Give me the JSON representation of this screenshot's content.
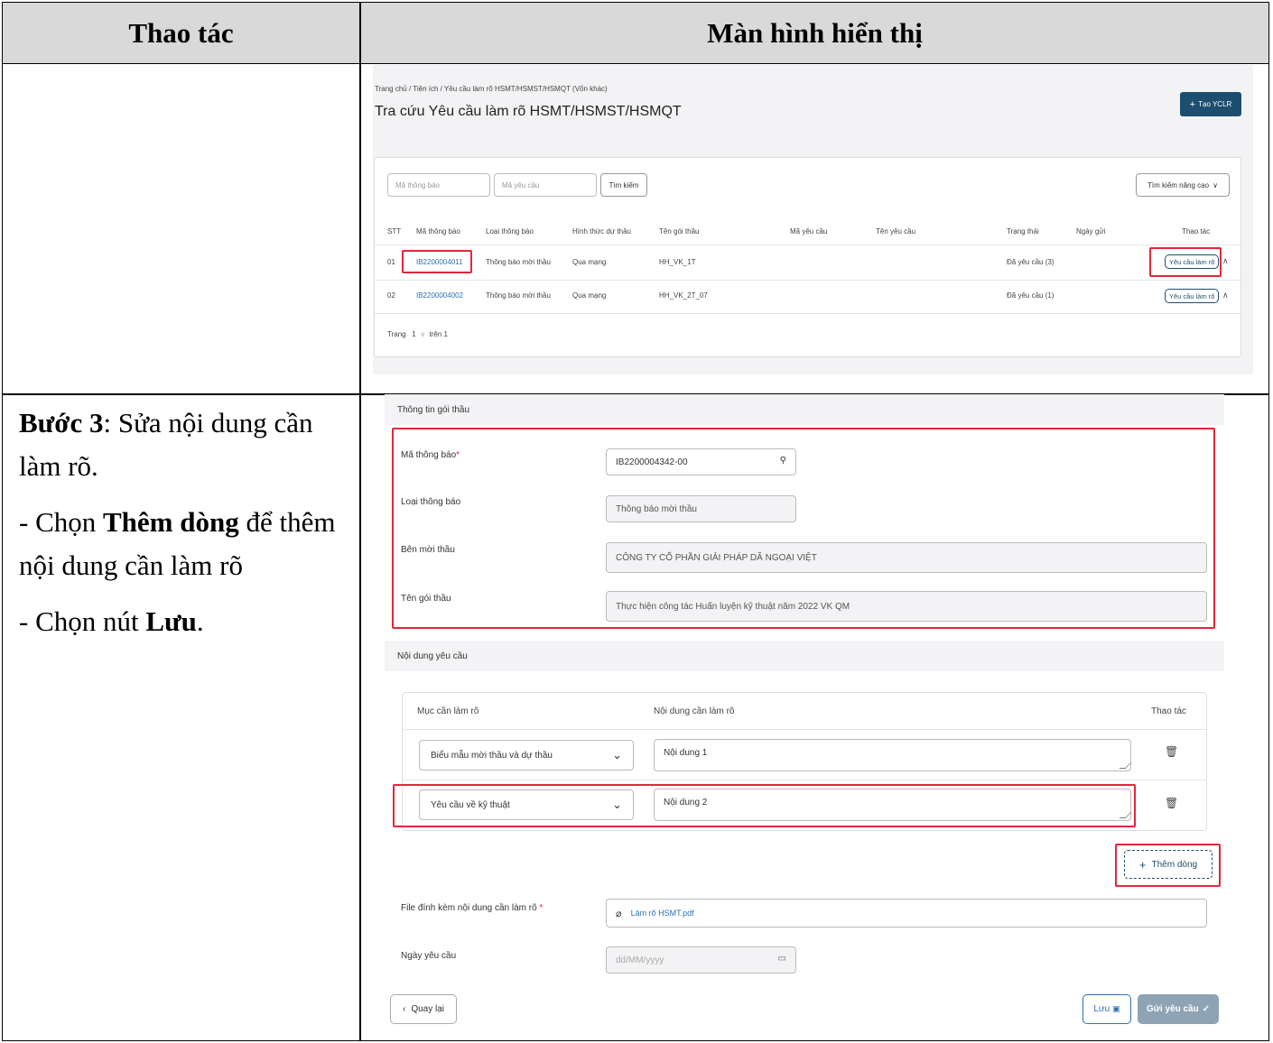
{
  "header": {
    "col_action": "Thao tác",
    "col_screen": "Màn hình hiển thị"
  },
  "instructions": {
    "step_bold": "Bước 3",
    "step_text": ": Sửa nội dung cần làm rõ.",
    "line2_pre": "- Chọn ",
    "line2_bold": "Thêm dòng",
    "line2_post": " để thêm nội dung cần làm rõ",
    "line3_pre": "- Chọn nút ",
    "line3_bold": "Lưu",
    "line3_post": "."
  },
  "screen1": {
    "breadcrumb": "Trang chủ / Tiện ích / Yêu cầu làm rõ HSMT/HSMST/HSMQT (Vốn khác)",
    "title": "Tra cứu Yêu cầu làm rõ HSMT/HSMST/HSMQT",
    "create_button": "Tạo YCLR",
    "search_notice_placeholder": "Mã thông báo",
    "search_request_placeholder": "Mã yêu cầu",
    "search_button": "Tìm kiếm",
    "advanced_search": "Tìm kiếm nâng cao",
    "columns": [
      "STT",
      "Mã thông báo",
      "Loại thông báo",
      "Hình thức dự thầu",
      "Tên gói thầu",
      "Mã yêu cầu",
      "Tên yêu cầu",
      "Trạng thái",
      "Ngày gửi",
      "Thao tác"
    ],
    "rows": [
      {
        "stt": "01",
        "code": "IB2200004011",
        "type": "Thông báo mời thầu",
        "form": "Qua mạng",
        "package": "HH_VK_1T",
        "status": "Đã yêu cầu (3)",
        "action": "Yêu cầu làm rõ"
      },
      {
        "stt": "02",
        "code": "IB2200004002",
        "type": "Thông báo mời thầu",
        "form": "Qua mạng",
        "package": "HH_VK_2T_07",
        "status": "Đã yêu cầu (1)",
        "action": "Yêu cầu làm rõ"
      }
    ],
    "pagination": {
      "label": "Trang",
      "page": "1",
      "of": "trên 1"
    }
  },
  "screen2": {
    "section_info": "Thông tin gói thầu",
    "label_notice_code": "Mã thông báo",
    "notice_code": "IB2200004342-00",
    "label_notice_type": "Loại thông báo",
    "notice_type": "Thông báo mời thầu",
    "label_inviter": "Bên mời thầu",
    "inviter": "CÔNG TY CỔ PHẦN GIẢI PHÁP DÃ NGOẠI VIỆT",
    "label_package": "Tên gói thầu",
    "package_name": "Thực hiện công tác Huấn luyện kỹ thuật năm 2022 VK QM",
    "section_content": "Nội dung yêu cầu",
    "col_item": "Mục cần làm rõ",
    "col_content": "Nội dung cần làm rõ",
    "col_action": "Thao tác",
    "rows": [
      {
        "item": "Biểu mẫu mời thầu và dự thầu",
        "content": "Nội dung 1"
      },
      {
        "item": "Yêu cầu về kỹ thuật",
        "content": "Nội dung 2"
      }
    ],
    "add_row_button": "Thêm dòng",
    "label_attachment": "File đính kèm nội dung cần làm rõ",
    "attachment": "Làm rõ HSMT.pdf",
    "label_date": "Ngày yêu cầu",
    "date_placeholder": "dd/MM/yyyy",
    "back_button": "Quay lại",
    "save_button": "Lưu",
    "send_button": "Gửi yêu cầu"
  }
}
